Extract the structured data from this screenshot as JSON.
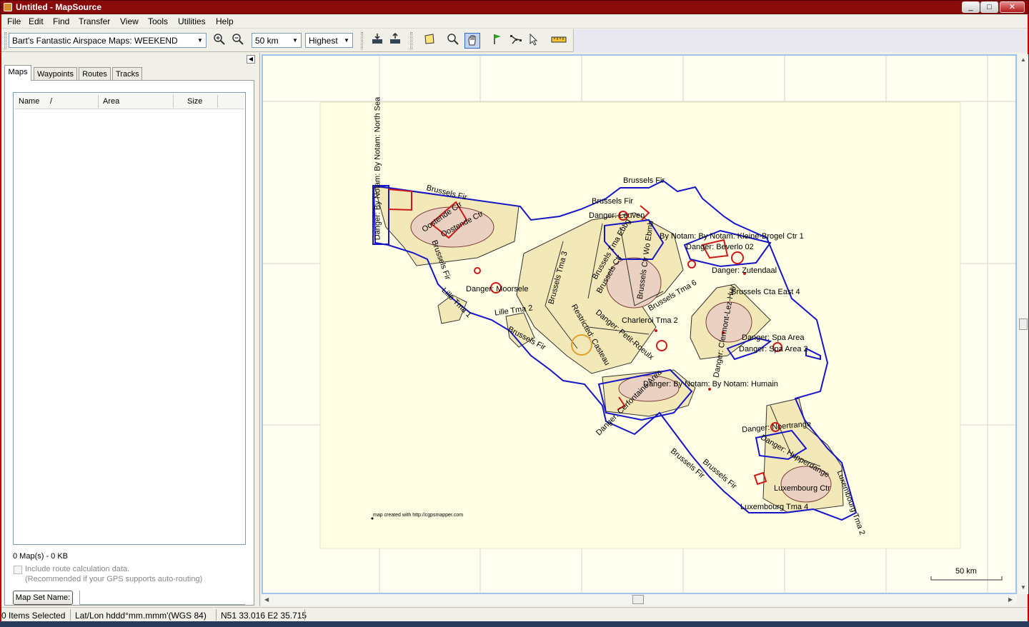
{
  "window": {
    "title": "Untitled - MapSource",
    "minimize": "_",
    "maximize": "□",
    "close": "✕"
  },
  "menu": [
    "File",
    "Edit",
    "Find",
    "Transfer",
    "View",
    "Tools",
    "Utilities",
    "Help"
  ],
  "toolbar": {
    "map_product": "Bart's Fantastic Airspace Maps: WEEKEND",
    "zoom_scale": "50 km",
    "detail": "Highest",
    "zoom_in_icon": "zoom-in-icon",
    "zoom_out_icon": "zoom-out-icon"
  },
  "left_panel": {
    "tabs": [
      "Maps",
      "Waypoints",
      "Routes",
      "Tracks"
    ],
    "active_tab": "Maps",
    "columns": [
      "Name",
      "/",
      "Area",
      "Size"
    ],
    "maps_count": "0 Map(s) - 0 KB",
    "route_calc_label": "Include route calculation data.",
    "route_calc_note": "(Recommended if your GPS supports auto-routing)",
    "mapset_button": "Map Set Name:",
    "mapset_value": ""
  },
  "map": {
    "labels": {
      "brussels_fir_top": "Brussels Fir",
      "brussels_fir_1": "Brussels Fir",
      "brussels_fir_nw": "Brussels Fir",
      "brussels_fir_w": "Brussels Fir",
      "brussels_fir_sw": "Brussels Fir",
      "brussels_fir_s1": "Brussels Fir",
      "brussels_fir_s2": "Brussels Fir",
      "north_sea": "Danger: By Notam: By Notam: North Sea",
      "oostende_ctr1": "Oostende Ctr",
      "oostende_ctr2": "Oostende Ctr",
      "lille_tma1": "Lille Tma 1",
      "lille_tma2": "Lille Tma 2",
      "moorsele": "Danger: Moorsele",
      "brussels_tma3": "Brussels Tma 3",
      "brussels_tma_ebbg": "Brussels Tma Ebbg",
      "brussels_ctr": "Brussels Ctr",
      "brussels_ctr_ebmb": "Brussels Ctr Wo Ebmb",
      "brussels_tma6": "Brussels Tma 6",
      "danger_leuven": "Danger: Leuven",
      "kleine_brogel": "By Notam: By Notam: Kleine-Brogel Ctr 1",
      "beverlo": "Danger: Beverlo 02",
      "zutendaal": "Danger: Zutendaal",
      "cta_east4": "Brussels Cta East 4",
      "clermont": "Danger: Clermont-Lez-Huy",
      "spa_area": "Danger: Spa Area",
      "spa_area2": "Danger: Spa Area 2",
      "charleroi_tma2": "Charleroi Tma 2",
      "restricted_casteau": "Restricted: Casteau",
      "roeulx": "Danger: Petit-Roeulx",
      "cerfontaine": "Danger: Cerfontaine Area",
      "humain": "Danger: By Notam: By Notam: Humain",
      "noertrange": "Danger: Noertrange",
      "hupperdange": "Danger: Hupperdange",
      "luxembourg_ctr": "Luxembourg Ctr",
      "luxembourg_tma4": "Luxembourg Tma 4",
      "luxembourg_tma2": "Luxembourg Tma 2",
      "credit": "map created with http://cgpsmapper.com"
    },
    "scale_label": "50 km"
  },
  "status": {
    "selection": "0 Items Selected",
    "position_format": "Lat/Lon hddd°mm.mmm'(WGS 84)",
    "cursor_position": "N51 33.016 E2 35.715"
  },
  "colors": {
    "title_bar": "#8a0b0b",
    "fir_boundary": "#1616c8",
    "airspace_fill": "#f3e9b8",
    "danger_red": "#cc1a1a",
    "map_background": "#fffef0"
  }
}
